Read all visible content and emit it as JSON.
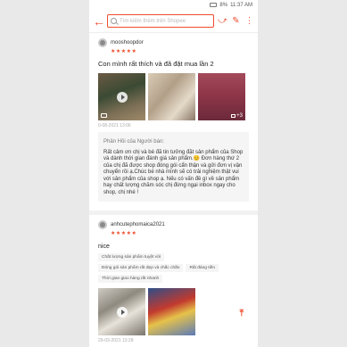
{
  "status": {
    "time": "11:37 AM",
    "battery": "8%"
  },
  "topbar": {
    "search_placeholder": "Tìm kiếm thêm trên Shopee"
  },
  "icons": {
    "back": "back-arrow-icon",
    "share": "share-icon",
    "edit": "edit-icon",
    "more": "more-vert-icon"
  },
  "accent": "#ee4d2d",
  "review1": {
    "username": "mooshoopdor",
    "stars": "★★★★★",
    "text": "Con mình rất thích và đã đặt mua lần 2",
    "more_count": "+3",
    "date": "0-08-2021 13:06",
    "reply_title": "Phản Hồi của Người bán:",
    "reply_text": "Rất cảm ơn chị và bé đã tin tưởng đặt sản phẩm của Shop  và dành thời gian đánh giá sản phẩm.😊 Đơn hàng thứ 2 của chị đã được shop đóng gói cẩn thận và gửi đơn vị vận chuyển rồi ạ.Chúc bé nhà mình sẽ có trải nghiệm thật vui với sản phẩm của shop ạ. Nếu có vấn đề gì về sản phẩm hay chất lượng chăm sóc chị đừng ngại inbox ngay cho shop, chị nhé !"
  },
  "review2": {
    "username": "anhcutephomaica2021",
    "stars": "★★★★★",
    "text": "nice",
    "tags": [
      "Chất lượng sản phẩm tuyệt vời",
      "Đóng gói sản phẩm rất đẹp và chắc chắn",
      "Rất đáng tiền",
      "Thời gian giao hàng rất nhanh"
    ],
    "date": "29-03-2021 13:28"
  },
  "scroll_top_icon": "arrow-up-icon"
}
